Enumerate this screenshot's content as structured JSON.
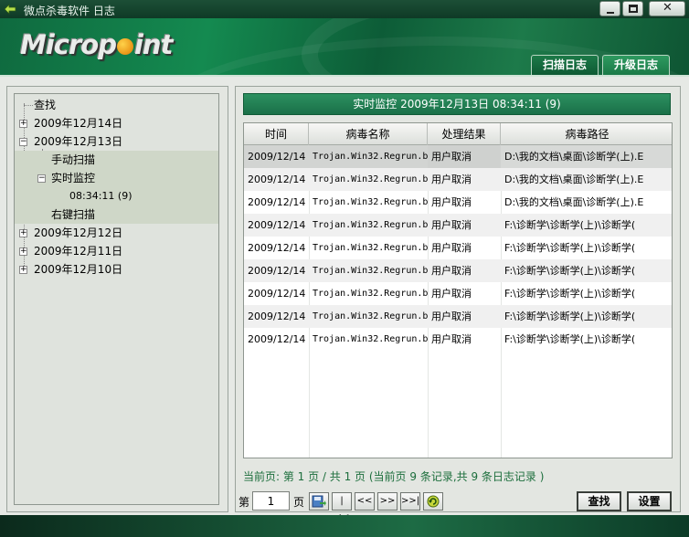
{
  "window": {
    "title": "微点杀毒软件 日志",
    "icon": "app-icon",
    "buttons": [
      "minimize-icon",
      "maximize-icon",
      "close-icon"
    ]
  },
  "header": {
    "logo_text": "Micropoint",
    "tabs": [
      "扫描日志",
      "升级日志"
    ]
  },
  "tree": {
    "items": [
      {
        "label": "查找"
      },
      {
        "label": "2009年12月14日",
        "expander": "+"
      },
      {
        "label": "2009年12月13日",
        "expander": "-"
      },
      {
        "label": "手动扫描"
      },
      {
        "label": "实时监控",
        "expander": "-"
      },
      {
        "label": "08:34:11 (9)"
      },
      {
        "label": "右键扫描"
      },
      {
        "label": "2009年12月12日",
        "expander": "+"
      },
      {
        "label": "2009年12月11日",
        "expander": "+"
      },
      {
        "label": "2009年12月10日",
        "expander": "+"
      }
    ]
  },
  "panel": {
    "header": "实时监控 2009年12月13日 08:34:11 (9)",
    "columns": [
      "时间",
      "病毒名称",
      "处理结果",
      "病毒路径"
    ],
    "rows": [
      [
        "2009/12/14",
        "Trojan.Win32.Regrun.b",
        "用户取消",
        "D:\\我的文档\\桌面\\诊断学(上).E"
      ],
      [
        "2009/12/14",
        "Trojan.Win32.Regrun.b",
        "用户取消",
        "D:\\我的文档\\桌面\\诊断学(上).E"
      ],
      [
        "2009/12/14",
        "Trojan.Win32.Regrun.b",
        "用户取消",
        "D:\\我的文档\\桌面\\诊断学(上).E"
      ],
      [
        "2009/12/14",
        "Trojan.Win32.Regrun.b",
        "用户取消",
        "F:\\诊断学\\诊断学(上)\\诊断学("
      ],
      [
        "2009/12/14",
        "Trojan.Win32.Regrun.b",
        "用户取消",
        "F:\\诊断学\\诊断学(上)\\诊断学("
      ],
      [
        "2009/12/14",
        "Trojan.Win32.Regrun.b",
        "用户取消",
        "F:\\诊断学\\诊断学(上)\\诊断学("
      ],
      [
        "2009/12/14",
        "Trojan.Win32.Regrun.b",
        "用户取消",
        "F:\\诊断学\\诊断学(上)\\诊断学("
      ],
      [
        "2009/12/14",
        "Trojan.Win32.Regrun.b",
        "用户取消",
        "F:\\诊断学\\诊断学(上)\\诊断学("
      ],
      [
        "2009/12/14",
        "Trojan.Win32.Regrun.b",
        "用户取消",
        "F:\\诊断学\\诊断学(上)\\诊断学("
      ]
    ],
    "status": "当前页: 第 1 页 / 共 1 页 (当前页 9 条记录,共 9 条日志记录 )",
    "pager": {
      "label_before": "第",
      "page_value": "1",
      "label_after": "页",
      "buttons": [
        "go-icon",
        "|<<",
        "<<",
        ">>",
        ">>|",
        "refresh-icon"
      ]
    },
    "actions": {
      "find": "查找",
      "settings": "设置"
    }
  }
}
